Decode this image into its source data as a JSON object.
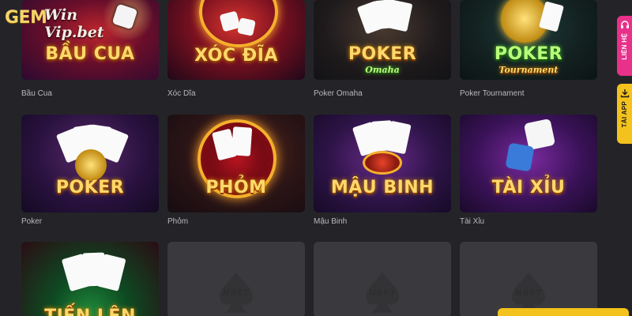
{
  "brand": {
    "logo_main": "GEM",
    "logo_script": "Win Vip.bet"
  },
  "games": [
    {
      "caption": "Bầu Cua",
      "art_title": "BẦU CUA",
      "art_sub": ""
    },
    {
      "caption": "Xóc Dĩa",
      "art_title": "XÓC ĐĨA",
      "art_sub": ""
    },
    {
      "caption": "Poker Omaha",
      "art_title": "POKER",
      "art_sub": "Omaha"
    },
    {
      "caption": "Poker Tournament",
      "art_title": "POKER",
      "art_sub": "Tournament"
    },
    {
      "caption": "Poker",
      "art_title": "POKER",
      "art_sub": ""
    },
    {
      "caption": "Phỏm",
      "art_title": "PHỎM",
      "art_sub": ""
    },
    {
      "caption": "Mậu Binh",
      "art_title": "MẬU BINH",
      "art_sub": ""
    },
    {
      "caption": "Tài Xỉu",
      "art_title": "TÀI XỈU",
      "art_sub": ""
    },
    {
      "caption": "",
      "art_title": "TIẾN LÊN",
      "art_sub": ""
    }
  ],
  "placeholders": [
    {
      "label": "NBET"
    },
    {
      "label": "NBET"
    },
    {
      "label": "NBET"
    }
  ],
  "side_tabs": {
    "contact": {
      "label": "LIÊN HỆ",
      "icon": "headset-icon"
    },
    "app": {
      "label": "TẢI APP",
      "icon": "download-icon"
    }
  },
  "colors": {
    "background": "#242428",
    "placeholder": "#3a3a3e",
    "contact_tab": "#e8318a",
    "app_tab": "#f4c21d",
    "caption": "#b9b9bd"
  }
}
